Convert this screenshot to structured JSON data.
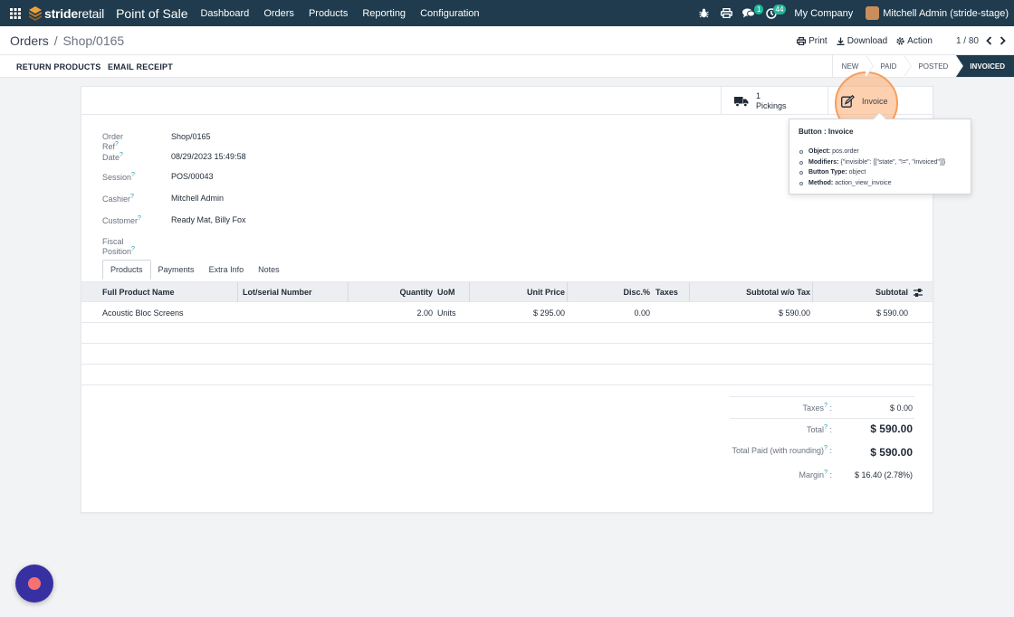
{
  "navbar": {
    "brand_bold": "stride",
    "brand_light": "retail",
    "app_name": "Point of Sale",
    "menu": [
      "Dashboard",
      "Orders",
      "Products",
      "Reporting",
      "Configuration"
    ],
    "messages_badge": "1",
    "activities_badge": "44",
    "company": "My Company",
    "user": "Mitchell Admin (stride-stage)"
  },
  "breadcrumb": {
    "parent": "Orders",
    "separator": "/",
    "current": "Shop/0165"
  },
  "actions": {
    "print": "Print",
    "download": "Download",
    "action": "Action"
  },
  "pager": {
    "value": "1 / 80"
  },
  "statusbar": {
    "buttons": [
      "RETURN PRODUCTS",
      "EMAIL RECEIPT"
    ],
    "stages": [
      "NEW",
      "PAID",
      "POSTED",
      "INVOICED"
    ],
    "active_stage": "INVOICED"
  },
  "smart_buttons": {
    "pickings_count": "1",
    "pickings_label": "Pickings",
    "invoice_label": "Invoice"
  },
  "fields": [
    {
      "label": "Order Ref",
      "value": "Shop/0165"
    },
    {
      "label": "Date",
      "value": "08/29/2023 15:49:58"
    },
    {
      "label": "Session",
      "value": "POS/00043"
    },
    {
      "label": "Cashier",
      "value": "Mitchell Admin"
    },
    {
      "label": "Customer",
      "value": "Ready Mat, Billy Fox"
    },
    {
      "label": "Fiscal Position",
      "value": ""
    }
  ],
  "help_mark": "?",
  "tabs": [
    "Products",
    "Payments",
    "Extra Info",
    "Notes"
  ],
  "table": {
    "headers": {
      "product": "Full Product Name",
      "lot": "Lot/serial Number",
      "qty": "Quantity",
      "uom": "UoM",
      "price": "Unit Price",
      "disc": "Disc.%",
      "taxes": "Taxes",
      "subtotal_wo": "Subtotal w/o Tax",
      "subtotal": "Subtotal"
    },
    "rows": [
      {
        "product": "Acoustic Bloc Screens",
        "lot": "",
        "qty": "2.00",
        "uom": "Units",
        "price": "$ 295.00",
        "disc": "0.00",
        "taxes": "",
        "subtotal_wo": "$ 590.00",
        "subtotal": "$ 590.00"
      }
    ]
  },
  "totals": {
    "taxes_label": "Taxes",
    "taxes": "$ 0.00",
    "total_label": "Total",
    "total": "$ 590.00",
    "paid_label": "Total Paid (with rounding)",
    "paid": "$ 590.00",
    "margin_label": "Margin",
    "margin": "$ 16.40 (2.78%)",
    "colon": ":"
  },
  "tooltip": {
    "title": "Button : Invoice",
    "items": [
      {
        "key": "Object:",
        "value": "pos.order"
      },
      {
        "key": "Modifiers:",
        "value": "{\"invisible\": [[\"state\", \"!=\", \"invoiced\"]]}"
      },
      {
        "key": "Button Type:",
        "value": "object"
      },
      {
        "key": "Method:",
        "value": "action_view_invoice"
      }
    ]
  },
  "colors": {
    "navbar": "#1f3b4d",
    "accent": "#21b799",
    "highlight": "#f59e5b"
  }
}
